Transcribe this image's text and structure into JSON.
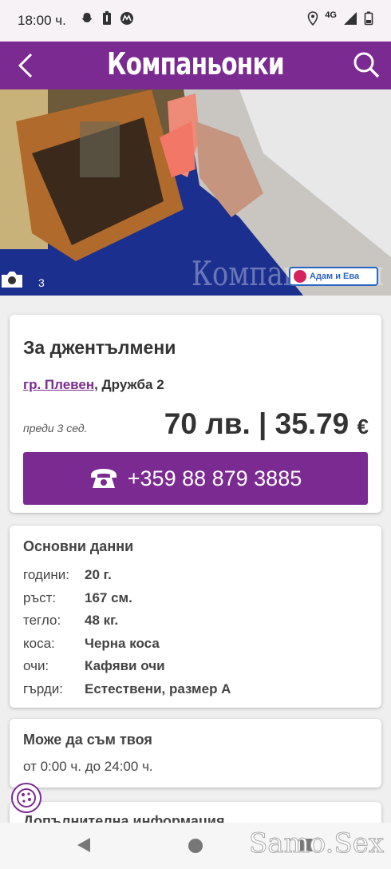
{
  "status": {
    "time": "18:00 ч.",
    "network": "4G"
  },
  "header": {
    "title": "Компаньонки"
  },
  "photo": {
    "count": "3",
    "watermark": "Компаньонки",
    "badge_text": "Адам и Ева"
  },
  "listing": {
    "title": "За джентълмени",
    "city_link": "гр. Плевен",
    "district": ", Дружба 2",
    "posted": "преди 3 сед.",
    "price": "70 лв. | 35.79",
    "currency": "€",
    "phone": "+359 88 879 3885"
  },
  "basic_data": {
    "title": "Основни данни",
    "rows": [
      {
        "label": "години:",
        "value": "20 г."
      },
      {
        "label": "ръст:",
        "value": "167 см."
      },
      {
        "label": "тегло:",
        "value": "48 кг."
      },
      {
        "label": "коса:",
        "value": "Черна коса"
      },
      {
        "label": "очи:",
        "value": "Кафяви очи"
      },
      {
        "label": "гърди:",
        "value": "Естествени, размер А"
      }
    ]
  },
  "availability": {
    "title": "Може да съм твоя",
    "hours": "от 0:00 ч. до 24:00 ч."
  },
  "extra": {
    "title": "Допълнителна информация"
  },
  "site_watermark": "Samo.Sex"
}
